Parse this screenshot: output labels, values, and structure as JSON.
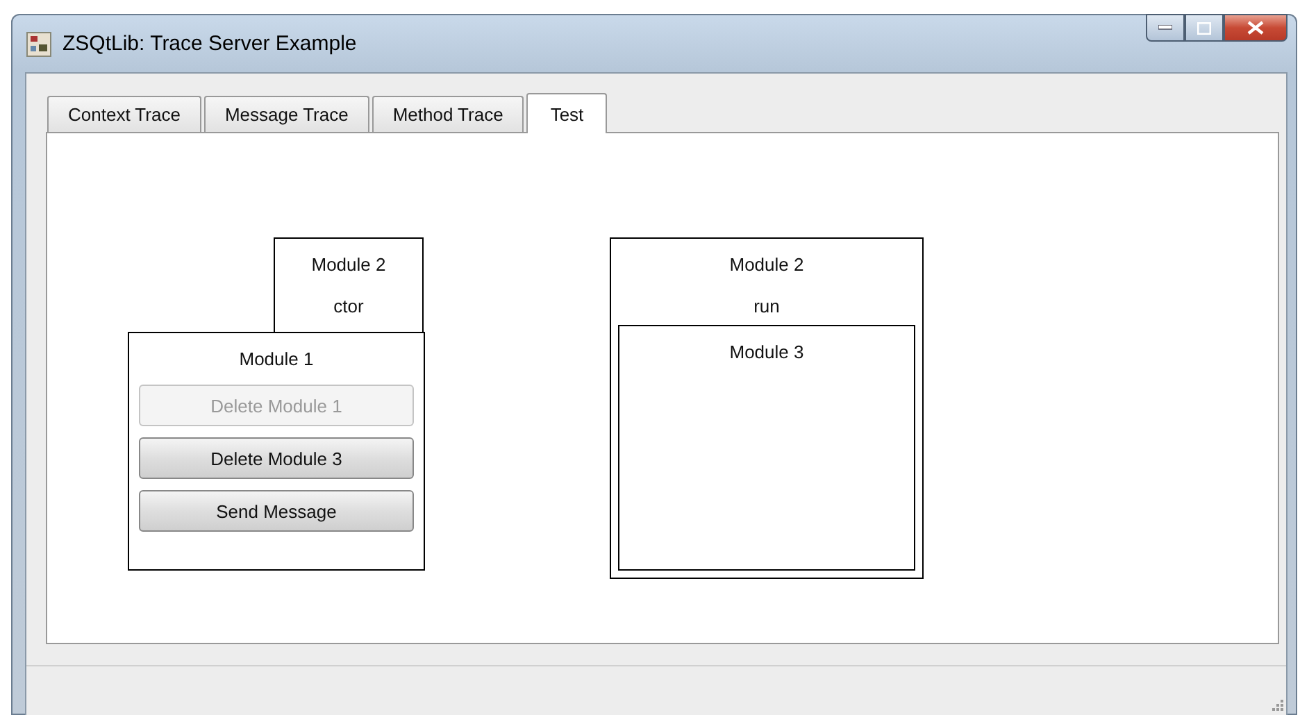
{
  "window": {
    "title": "ZSQtLib: Trace Server Example"
  },
  "tabs": [
    {
      "label": "Context Trace",
      "selected": false
    },
    {
      "label": "Message Trace",
      "selected": false
    },
    {
      "label": "Method Trace",
      "selected": false
    },
    {
      "label": "Test",
      "selected": true
    }
  ],
  "modules": [
    {
      "title": "Module 2",
      "subtitle": "ctor"
    },
    {
      "title": "Module 1",
      "buttons": [
        {
          "label": "Delete Module 1",
          "disabled": true
        },
        {
          "label": "Delete Module 3",
          "disabled": false
        },
        {
          "label": "Send Message",
          "disabled": false
        }
      ]
    },
    {
      "title": "Module 2",
      "subtitle": "run",
      "children": [
        {
          "title": "Module 3"
        }
      ]
    }
  ]
}
